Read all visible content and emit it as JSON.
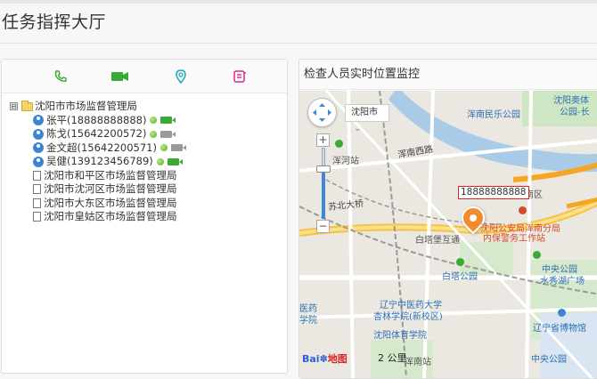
{
  "page": {
    "title": "任务指挥大厅"
  },
  "toolbar": {
    "icons": [
      "phone-icon",
      "video-camera-icon",
      "location-icon",
      "note-icon"
    ]
  },
  "tree": {
    "root": {
      "toggle": "⊟",
      "label": "沈阳市市场监督管理局"
    },
    "people": [
      {
        "label": "张平(18888888888)",
        "online": true,
        "video": true
      },
      {
        "label": "陈戈(15642200572)",
        "online": true,
        "video": false
      },
      {
        "label": "金文超(15642200571)",
        "online": true,
        "video": false
      },
      {
        "label": "吴健(13912345678​9)",
        "online": true,
        "video": true
      }
    ],
    "branches": [
      "沈阳市和平区市场监督管理局",
      "沈阳市沈河区市场监督管理局",
      "沈阳市大东区市场监督管理局",
      "沈阳市皇姑区市场监督管理局"
    ]
  },
  "map_panel": {
    "title": "检查人员实时位置监控",
    "city": "沈阳市",
    "city_arrow": "⌄",
    "marker_label": "18888888888",
    "marker_caption_line1": "沈阳公安局浑南分局",
    "marker_caption_line2": "内保警务工作站",
    "logo_text": "Bai",
    "logo_suffix": "地图",
    "scale_text": "2 公里",
    "labels": {
      "park1": "浑南民乐公园",
      "station1": "浑河站",
      "road1": "浑南西路",
      "bridge": "苏北大桥",
      "area": "南区",
      "tower": "白塔堡互通",
      "park2": "白塔公园",
      "park3": "中央公园",
      "square": "水秀湖广场",
      "uni": "辽宁中医药大学",
      "campus": "杏林学院(新校区)",
      "gym": "沈阳体育学院",
      "museum": "辽宁省博物馆",
      "south": "浑南站",
      "park4": "中央公园",
      "top_right": "沈阳奥体",
      "top_right2": "公园-长",
      "left1": "医药",
      "left2": "学院"
    }
  }
}
